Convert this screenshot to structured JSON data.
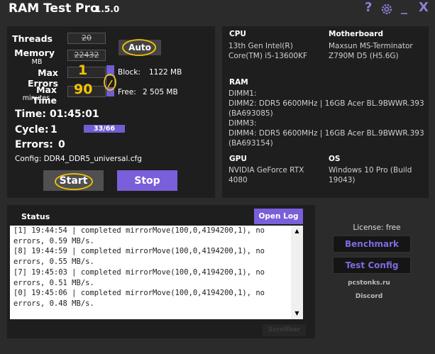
{
  "app": {
    "title": "RAM Test Pro",
    "version": "1.5.0"
  },
  "window_icons": {
    "help": "?",
    "settings": "⚙",
    "minimize": "_",
    "close": "X"
  },
  "controls": {
    "threads_label": "Threads",
    "threads_value": "20",
    "memory_label": "Memory",
    "memory_unit": "MB",
    "memory_value": "22432",
    "max_errors_label": "Max Errors",
    "max_errors_value": "1",
    "max_time_label": "Max Time",
    "max_time_unit": "minutes",
    "max_time_value": "90",
    "auto_button": "Auto",
    "block_label": "Block:",
    "block_value": "1122 MB",
    "free_label": "Free:",
    "free_value": "2 505 MB",
    "time_label": "Time:",
    "time_value": "01:45:01",
    "cycle_label": "Cycle:",
    "cycle_value": "1",
    "cycle_progress": "33/66",
    "errors_label": "Errors:",
    "errors_value": "0",
    "config_text": "Config: DDR4_DDR5_universal.cfg",
    "start_button": "Start",
    "stop_button": "Stop"
  },
  "info": {
    "cpu_head": "CPU",
    "cpu_lines": [
      "13th Gen Intel(R)",
      "Core(TM) i5-13600KF"
    ],
    "mb_head": "Motherboard",
    "mb_lines": [
      "Maxsun MS-Terminator",
      "Z790M D5 (H5.6G)"
    ],
    "ram_head": "RAM",
    "ram_lines": [
      "DIMM1:",
      "DIMM2: DDR5 6600MHz | 16GB Acer BL.9BWWR.393",
      "(BA693085)",
      "DIMM3:",
      "DIMM4: DDR5 6600MHz | 16GB Acer BL.9BWWR.393",
      "(BA693154)"
    ],
    "gpu_head": "GPU",
    "gpu_lines": [
      "NVIDIA GeForce RTX",
      "4080"
    ],
    "os_head": "OS",
    "os_lines": [
      "Windows 10 Pro (Build",
      "19043)"
    ]
  },
  "status": {
    "title": "Status",
    "open_log": "Open Log",
    "log_lines": [
      "[1] 19:44:54 | completed mirrorMove(100,0,4194200,1), no",
      "errors, 0.59 MB/s.",
      "[8] 19:44:59 | completed mirrorMove(100,0,4194200,1), no",
      "errors, 0.55 MB/s.",
      "[7] 19:45:03 | completed mirrorMove(100,0,4194200,1), no",
      "errors, 0.51 MB/s.",
      "[0] 19:45:06 | completed mirrorMove(100,0,4194200,1), no",
      "errors, 0.48 MB/s."
    ],
    "scrollbar_label": "Scrollbar"
  },
  "side": {
    "license": "License: free",
    "benchmark": "Benchmark",
    "test_config": "Test Config",
    "site": "pcstonks.ru",
    "discord": "Discord"
  },
  "colors": {
    "accent": "#7b5ed9",
    "panel": "#1e1e1e",
    "background": "#2b2b2b",
    "annotation": "#f5c400"
  }
}
